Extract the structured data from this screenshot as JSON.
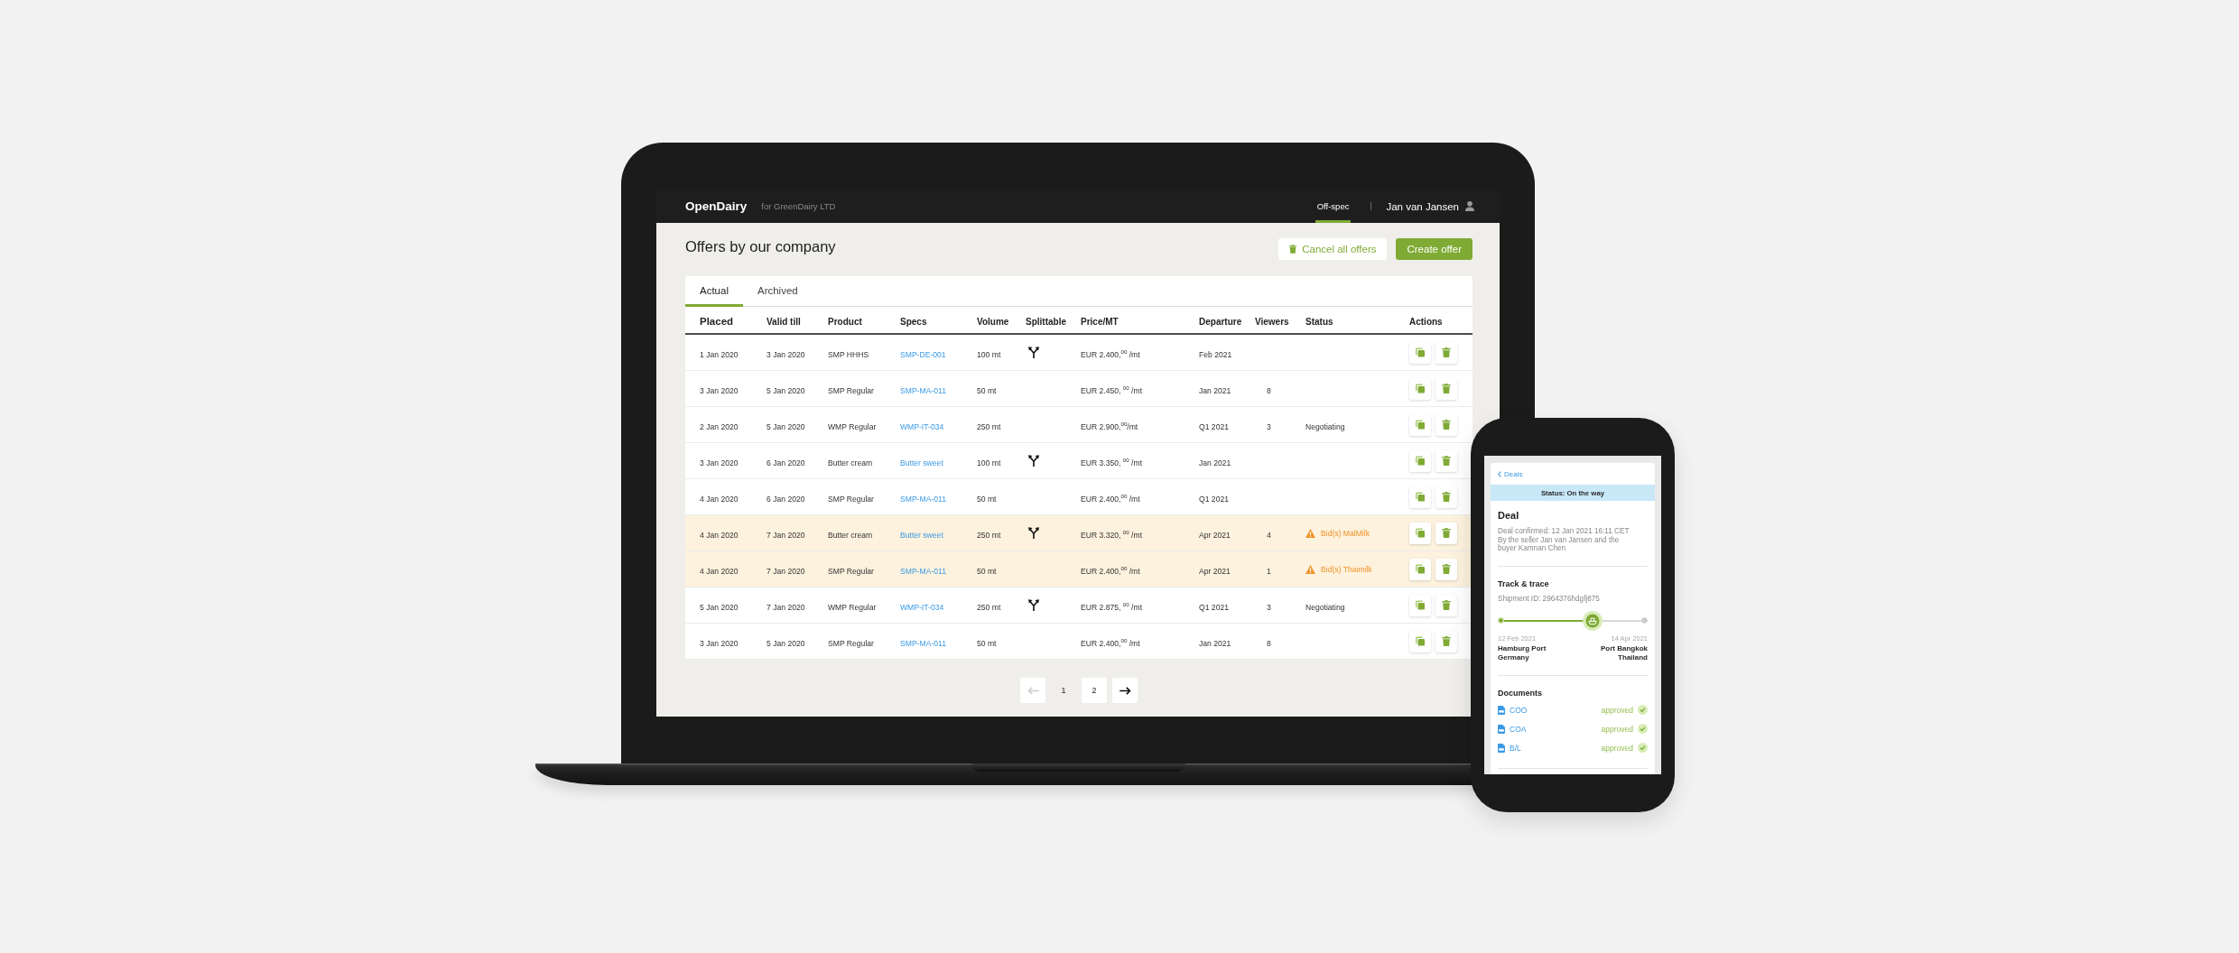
{
  "laptop": {
    "header": {
      "brand": "OpenDairy",
      "company": "for GreenDairy LTD",
      "nav": [
        {
          "label": "Off-spec",
          "selected": true
        }
      ],
      "user": "Jan van Jansen"
    },
    "page": {
      "title": "Offers by our company",
      "buttons": [
        {
          "label": "Cancel all offers",
          "kind": "secondary"
        },
        {
          "label": "Create offer",
          "kind": "primary"
        }
      ]
    },
    "tabs": [
      {
        "label": "Actual",
        "selected": true
      },
      {
        "label": "Archived",
        "selected": false
      }
    ],
    "table": {
      "columns": [
        "Placed",
        "Valid till",
        "Product",
        "Specs",
        "Volume",
        "Splittable",
        "Price/MT",
        "Departure",
        "Viewers",
        "Status",
        "Actions"
      ],
      "rows": [
        {
          "placed": "1 Jan 2020",
          "valid_till": "3 Jan 2020",
          "product": "SMP HHHS",
          "specs": "SMP-DE-001",
          "volume": "100 mt",
          "splittable": true,
          "price": "EUR 2.400,$^{00}$ /mt",
          "departure": "Feb 2021",
          "highlighted": false
        },
        {
          "placed": "3 Jan 2020",
          "valid_till": "5 Jan 2020",
          "product": "SMP Regular",
          "specs": "SMP-MA-011",
          "volume": "50 mt",
          "splittable": false,
          "price": "EUR 2.450, $^{00}$ /mt",
          "departure": "Jan 2021",
          "viewers": "8",
          "highlighted": false
        },
        {
          "placed": "2 Jan 2020",
          "valid_till": "5 Jan 2020",
          "product": "WMP Regular",
          "specs": "WMP-IT-034",
          "volume": "250 mt",
          "splittable": false,
          "price": "EUR 2.900,$^{00}$/mt",
          "departure": "Q1 2021",
          "viewers": "3",
          "status": {
            "kind": "plain",
            "text": "Negotiating"
          },
          "highlighted": false
        },
        {
          "placed": "3 Jan 2020",
          "valid_till": "6 Jan 2020",
          "product": "Butter cream",
          "specs": "Butter sweet",
          "volume": "100 mt",
          "splittable": true,
          "price": "EUR 3.350, $^{00}$ /mt",
          "departure": "Jan 2021",
          "highlighted": false
        },
        {
          "placed": "4 Jan 2020",
          "valid_till": "6 Jan 2020",
          "product": "SMP Regular",
          "specs": "SMP-MA-011",
          "volume": "50 mt",
          "splittable": false,
          "price": "EUR 2.400,$^{00}$ /mt",
          "departure": "Q1 2021",
          "highlighted": false
        },
        {
          "placed": "4 Jan 2020",
          "valid_till": "7 Jan 2020",
          "product": "Butter cream",
          "specs": "Butter sweet",
          "volume": "250 mt",
          "splittable": true,
          "price": "EUR 3.320, $^{00}$ /mt",
          "departure": "Apr 2021",
          "viewers": "4",
          "status": {
            "kind": "warning",
            "text": "Bid(s) MalMilk"
          },
          "highlighted": true
        },
        {
          "placed": "4 Jan 2020",
          "valid_till": "7 Jan 2020",
          "product": "SMP Regular",
          "specs": "SMP-MA-011",
          "volume": "50 mt",
          "splittable": false,
          "price": "EUR 2.400,$^{00}$ /mt",
          "departure": "Apr 2021",
          "viewers": "1",
          "status": {
            "kind": "warning",
            "text": "Bid(s) Thaimilk"
          },
          "highlighted": true
        },
        {
          "placed": "5 Jan 2020",
          "valid_till": "7 Jan 2020",
          "product": "WMP Regular",
          "specs": "WMP-IT-034",
          "volume": "250 mt",
          "splittable": true,
          "price": "EUR 2.875, $^{00}$ /mt",
          "departure": "Q1 2021",
          "viewers": "3",
          "status": {
            "kind": "plain",
            "text": "Negotiating"
          },
          "highlighted": false
        },
        {
          "placed": "3 Jan 2020",
          "valid_till": "5 Jan 2020",
          "product": "SMP Regular",
          "specs": "SMP-MA-011",
          "volume": "50 mt",
          "splittable": false,
          "price": "EUR 2.400,$^{00}$ /mt",
          "departure": "Jan 2021",
          "viewers": "8",
          "highlighted": false
        }
      ]
    },
    "pagination": {
      "prev": {
        "disabled": true
      },
      "pages": [
        {
          "label": "1",
          "selected": true
        },
        {
          "label": "2",
          "selected": false
        }
      ],
      "next": {
        "disabled": false
      }
    }
  },
  "phone": {
    "back": "Deals",
    "status": "Status: On the way",
    "deal": {
      "title": "Deal",
      "confirmed": "Deal confirmed: 12 Jan 2021 16:11 CET",
      "parties": "By the seller Jan van Jansen and the buyer Kamnan Chen"
    },
    "tracking": {
      "title": "Track & trace",
      "shipment": "Shipment ID: 2964376hdgfj875",
      "level": 0.63,
      "origin": {
        "date": "12 Feb 2021",
        "place": "Hamburg Port",
        "country": "Germany"
      },
      "destination": {
        "date": "14 Apr 2021",
        "place": "Port Bangkok",
        "country": "Thailand"
      }
    },
    "documents": {
      "title": "Documents",
      "items": [
        {
          "name": "COO",
          "status": "approved",
          "approved": true
        },
        {
          "name": "COA",
          "status": "approved",
          "approved": true
        },
        {
          "name": "B/L",
          "status": "approved",
          "approved": true
        }
      ]
    }
  }
}
